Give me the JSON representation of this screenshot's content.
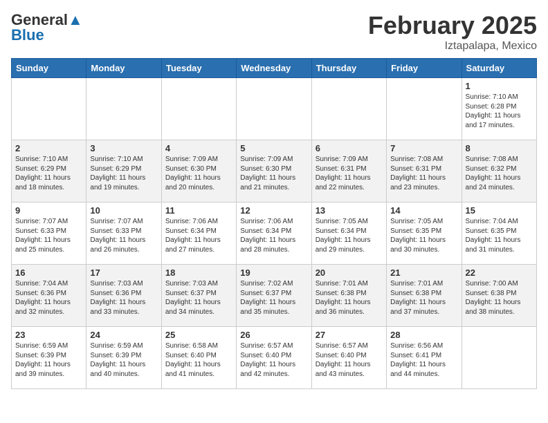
{
  "logo": {
    "general": "General",
    "blue": "Blue"
  },
  "header": {
    "title": "February 2025",
    "subtitle": "Iztapalapa, Mexico"
  },
  "weekdays": [
    "Sunday",
    "Monday",
    "Tuesday",
    "Wednesday",
    "Thursday",
    "Friday",
    "Saturday"
  ],
  "weeks": [
    [
      {
        "day": "",
        "info": ""
      },
      {
        "day": "",
        "info": ""
      },
      {
        "day": "",
        "info": ""
      },
      {
        "day": "",
        "info": ""
      },
      {
        "day": "",
        "info": ""
      },
      {
        "day": "",
        "info": ""
      },
      {
        "day": "1",
        "info": "Sunrise: 7:10 AM\nSunset: 6:28 PM\nDaylight: 11 hours and 17 minutes."
      }
    ],
    [
      {
        "day": "2",
        "info": "Sunrise: 7:10 AM\nSunset: 6:29 PM\nDaylight: 11 hours and 18 minutes."
      },
      {
        "day": "3",
        "info": "Sunrise: 7:10 AM\nSunset: 6:29 PM\nDaylight: 11 hours and 19 minutes."
      },
      {
        "day": "4",
        "info": "Sunrise: 7:09 AM\nSunset: 6:30 PM\nDaylight: 11 hours and 20 minutes."
      },
      {
        "day": "5",
        "info": "Sunrise: 7:09 AM\nSunset: 6:30 PM\nDaylight: 11 hours and 21 minutes."
      },
      {
        "day": "6",
        "info": "Sunrise: 7:09 AM\nSunset: 6:31 PM\nDaylight: 11 hours and 22 minutes."
      },
      {
        "day": "7",
        "info": "Sunrise: 7:08 AM\nSunset: 6:31 PM\nDaylight: 11 hours and 23 minutes."
      },
      {
        "day": "8",
        "info": "Sunrise: 7:08 AM\nSunset: 6:32 PM\nDaylight: 11 hours and 24 minutes."
      }
    ],
    [
      {
        "day": "9",
        "info": "Sunrise: 7:07 AM\nSunset: 6:33 PM\nDaylight: 11 hours and 25 minutes."
      },
      {
        "day": "10",
        "info": "Sunrise: 7:07 AM\nSunset: 6:33 PM\nDaylight: 11 hours and 26 minutes."
      },
      {
        "day": "11",
        "info": "Sunrise: 7:06 AM\nSunset: 6:34 PM\nDaylight: 11 hours and 27 minutes."
      },
      {
        "day": "12",
        "info": "Sunrise: 7:06 AM\nSunset: 6:34 PM\nDaylight: 11 hours and 28 minutes."
      },
      {
        "day": "13",
        "info": "Sunrise: 7:05 AM\nSunset: 6:34 PM\nDaylight: 11 hours and 29 minutes."
      },
      {
        "day": "14",
        "info": "Sunrise: 7:05 AM\nSunset: 6:35 PM\nDaylight: 11 hours and 30 minutes."
      },
      {
        "day": "15",
        "info": "Sunrise: 7:04 AM\nSunset: 6:35 PM\nDaylight: 11 hours and 31 minutes."
      }
    ],
    [
      {
        "day": "16",
        "info": "Sunrise: 7:04 AM\nSunset: 6:36 PM\nDaylight: 11 hours and 32 minutes."
      },
      {
        "day": "17",
        "info": "Sunrise: 7:03 AM\nSunset: 6:36 PM\nDaylight: 11 hours and 33 minutes."
      },
      {
        "day": "18",
        "info": "Sunrise: 7:03 AM\nSunset: 6:37 PM\nDaylight: 11 hours and 34 minutes."
      },
      {
        "day": "19",
        "info": "Sunrise: 7:02 AM\nSunset: 6:37 PM\nDaylight: 11 hours and 35 minutes."
      },
      {
        "day": "20",
        "info": "Sunrise: 7:01 AM\nSunset: 6:38 PM\nDaylight: 11 hours and 36 minutes."
      },
      {
        "day": "21",
        "info": "Sunrise: 7:01 AM\nSunset: 6:38 PM\nDaylight: 11 hours and 37 minutes."
      },
      {
        "day": "22",
        "info": "Sunrise: 7:00 AM\nSunset: 6:38 PM\nDaylight: 11 hours and 38 minutes."
      }
    ],
    [
      {
        "day": "23",
        "info": "Sunrise: 6:59 AM\nSunset: 6:39 PM\nDaylight: 11 hours and 39 minutes."
      },
      {
        "day": "24",
        "info": "Sunrise: 6:59 AM\nSunset: 6:39 PM\nDaylight: 11 hours and 40 minutes."
      },
      {
        "day": "25",
        "info": "Sunrise: 6:58 AM\nSunset: 6:40 PM\nDaylight: 11 hours and 41 minutes."
      },
      {
        "day": "26",
        "info": "Sunrise: 6:57 AM\nSunset: 6:40 PM\nDaylight: 11 hours and 42 minutes."
      },
      {
        "day": "27",
        "info": "Sunrise: 6:57 AM\nSunset: 6:40 PM\nDaylight: 11 hours and 43 minutes."
      },
      {
        "day": "28",
        "info": "Sunrise: 6:56 AM\nSunset: 6:41 PM\nDaylight: 11 hours and 44 minutes."
      },
      {
        "day": "",
        "info": ""
      }
    ]
  ]
}
